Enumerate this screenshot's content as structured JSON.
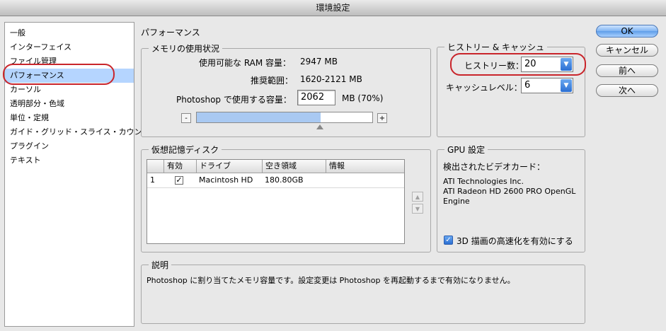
{
  "window": {
    "title": "環境設定"
  },
  "sidebar": {
    "items": [
      {
        "label": "一般"
      },
      {
        "label": "インターフェイス"
      },
      {
        "label": "ファイル管理"
      },
      {
        "label": "パフォーマンス",
        "selected": true
      },
      {
        "label": "カーソル"
      },
      {
        "label": "透明部分・色域"
      },
      {
        "label": "単位・定規"
      },
      {
        "label": "ガイド・グリッド・スライス・カウント"
      },
      {
        "label": "プラグイン"
      },
      {
        "label": "テキスト"
      }
    ]
  },
  "main": {
    "title": "パフォーマンス"
  },
  "memory": {
    "group_label": "メモリの使用状況",
    "available_label": "使用可能な RAM 容量：",
    "available_value": "2947 MB",
    "ideal_label": "推奨範囲：",
    "ideal_value": "1620-2121 MB",
    "use_label": "Photoshop で使用する容量：",
    "use_value": "2062",
    "use_unit": "MB (70%)",
    "slider_fraction": 0.7,
    "minus": "-",
    "plus": "+"
  },
  "history_cache": {
    "group_label": "ヒストリー & キャッシュ",
    "history_label": "ヒストリー数：",
    "history_value": "20",
    "cache_label": "キャッシュレベル：",
    "cache_value": "6"
  },
  "scratch": {
    "group_label": "仮想記憶ディスク",
    "columns": [
      "有効",
      "ドライブ",
      "空き領域",
      "情報"
    ],
    "rows": [
      {
        "index": "1",
        "active": true,
        "drive": "Macintosh HD",
        "free": "180.80GB",
        "info": ""
      }
    ],
    "up_arrow": "▲",
    "down_arrow": "▼"
  },
  "gpu": {
    "group_label": "GPU 設定",
    "detected_label": "検出されたビデオカード：",
    "card_line1": "ATI Technologies Inc.",
    "card_line2": "ATI Radeon HD 2600 PRO OpenGL",
    "card_line3": "Engine",
    "opengl_label": "3D 描画の高速化を有効にする",
    "opengl_checked": true
  },
  "description": {
    "group_label": "説明",
    "text": "Photoshop に割り当てたメモリ容量です。設定変更は Photoshop を再起動するまで有効になりません。"
  },
  "buttons": {
    "ok": "OK",
    "cancel": "キャンセル",
    "prev": "前へ",
    "next": "次へ"
  },
  "glyphs": {
    "check": "✓",
    "dropdown": "▼"
  },
  "colors": {
    "accent": "#3b7fe0",
    "highlight": "#c9252b",
    "selection": "#b5d5ff"
  }
}
